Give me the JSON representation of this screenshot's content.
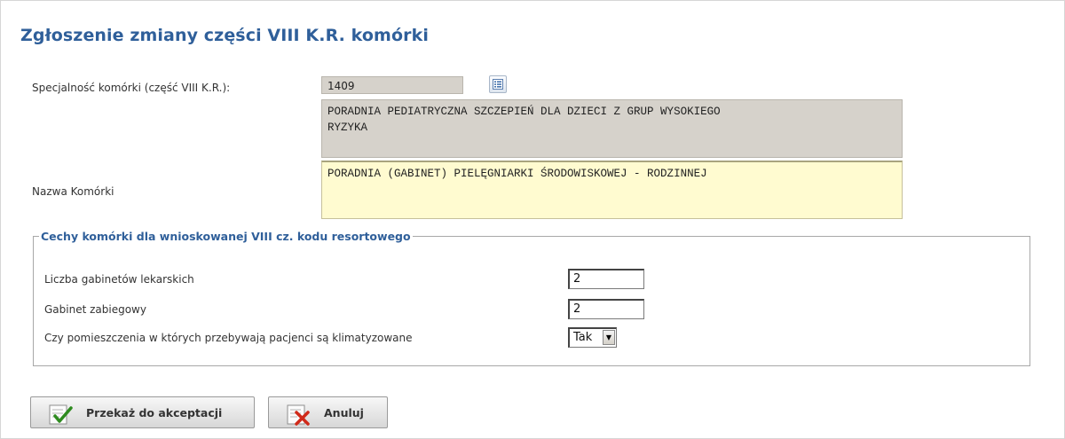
{
  "page": {
    "title": "Zgłoszenie zmiany części VIII K.R. komórki"
  },
  "specialty": {
    "label": "Specjalność komórki (część VIII K.R.):",
    "code": "1409",
    "description": "PORADNIA PEDIATRYCZNA SZCZEPIEŃ DLA DZIECI Z GRUP WYSOKIEGO\nRYZYKA",
    "list_button_icon": "list-icon"
  },
  "cell_name": {
    "label": "Nazwa Komórki",
    "value": "PORADNIA (GABINET) PIELĘGNIARKI ŚRODOWISKOWEJ - RODZINNEJ"
  },
  "features": {
    "legend": "Cechy komórki dla wnioskowanej VIII cz. kodu resortowego",
    "rows": [
      {
        "label": "Liczba gabinetów lekarskich",
        "value": "2"
      },
      {
        "label": "Gabinet zabiegowy",
        "value": "2"
      },
      {
        "label": "Czy pomieszczenia w których przebywają pacjenci są klimatyzowane",
        "value": "Tak"
      }
    ]
  },
  "actions": {
    "submit": {
      "label": "Przekaż do akceptacji",
      "icon": "checkmark-document-icon"
    },
    "cancel": {
      "label": "Anuluj",
      "icon": "cross-document-icon"
    }
  },
  "colors": {
    "title": "#2f5f9a",
    "readonly_bg": "#d6d2cb",
    "editable_bg": "#fffbd0"
  }
}
